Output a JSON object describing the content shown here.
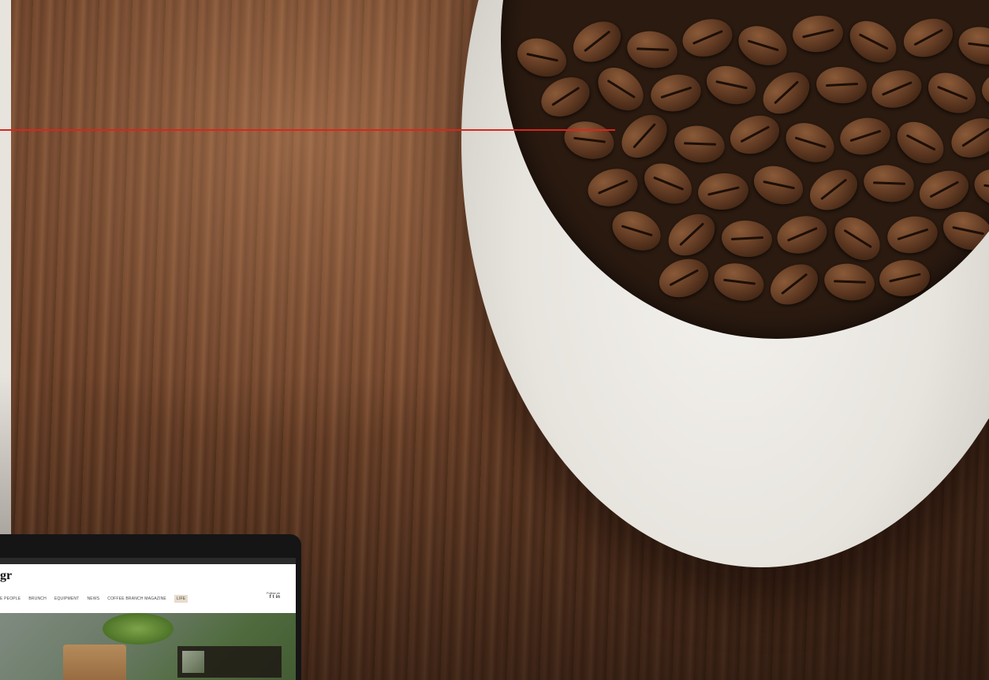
{
  "laptop_site": {
    "topbar_text": "",
    "logo": "gr",
    "nav": [
      {
        "label": "E PEOPLE"
      },
      {
        "label": "BRUNCH"
      },
      {
        "label": "EQUIPMENT"
      },
      {
        "label": "NEWS"
      },
      {
        "label": "COFFEE BRANCH MAGAZINE"
      },
      {
        "label": "LIFE",
        "active": true
      }
    ],
    "follow_label": "Follow us",
    "social": [
      "f",
      "t",
      "in"
    ],
    "hero_card_text": "",
    "hero_headline": ""
  },
  "colors": {
    "annotation_line": "#d9261c"
  }
}
